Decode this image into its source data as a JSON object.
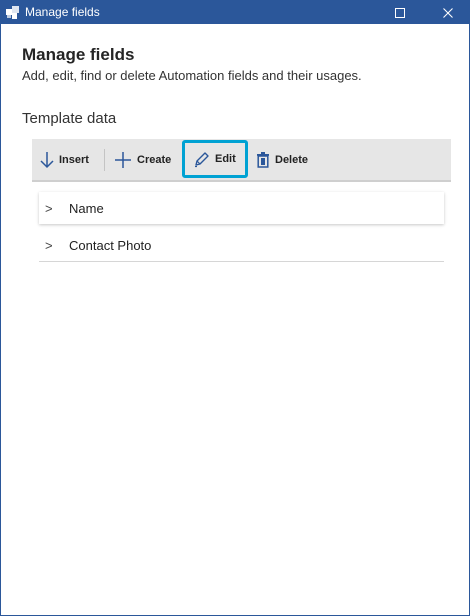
{
  "window": {
    "title": "Manage fields",
    "maximize_glyph": "□",
    "close_glyph": "✕",
    "colors": {
      "titlebar": "#2b579a",
      "accent": "#00a2d3"
    }
  },
  "header": {
    "title": "Manage fields",
    "subtitle": "Add, edit, find or delete Automation fields and their usages."
  },
  "section": {
    "title": "Template data"
  },
  "toolbar": {
    "insert_label": "Insert",
    "create_label": "Create",
    "edit_label": "Edit",
    "delete_label": "Delete",
    "highlighted": "edit"
  },
  "tree": {
    "chevron": ">",
    "items": [
      {
        "label": "Name",
        "icon": "chevron-right-icon",
        "expanded": false
      },
      {
        "label": "Contact Photo",
        "icon": "chevron-right-icon",
        "expanded": false
      }
    ]
  }
}
